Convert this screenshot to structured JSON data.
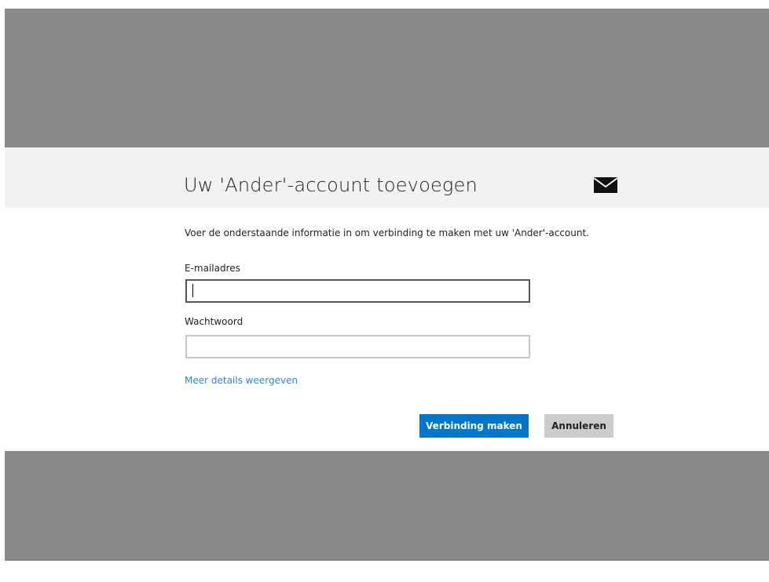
{
  "dialog": {
    "title": "Uw 'Ander'-account toevoegen",
    "header_icon": "mail-icon",
    "description": "Voer de onderstaande informatie in om verbinding te maken met uw 'Ander'-account.",
    "email": {
      "label": "E-mailadres",
      "value": "",
      "placeholder": ""
    },
    "password": {
      "label": "Wachtwoord",
      "value": "",
      "placeholder": ""
    },
    "details_link": "Meer details weergeven",
    "buttons": {
      "connect": "Verbinding maken",
      "cancel": "Annuleren"
    }
  },
  "colors": {
    "overlay": "#8a8a8a",
    "header_band": "#f2f2f2",
    "accent": "#0077cc",
    "link": "#2a8ae0",
    "secondary_button": "#cccccc"
  }
}
